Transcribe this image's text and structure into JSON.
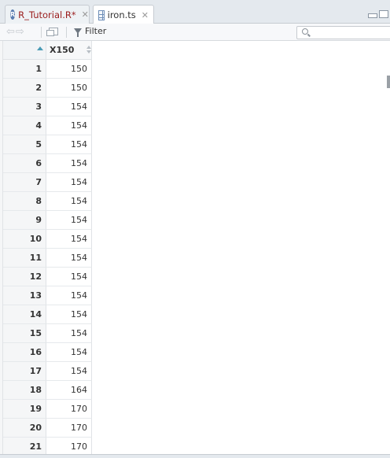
{
  "tabs": [
    {
      "label": "R_Tutorial.R*",
      "icon": "r-script-icon",
      "active": false
    },
    {
      "label": "iron.ts",
      "icon": "data-grid-icon",
      "active": true
    }
  ],
  "toolbar": {
    "filter_label": "Filter",
    "search_placeholder": ""
  },
  "table": {
    "column_header": "X150",
    "rows": [
      {
        "index": "1",
        "value": "150"
      },
      {
        "index": "2",
        "value": "150"
      },
      {
        "index": "3",
        "value": "154"
      },
      {
        "index": "4",
        "value": "154"
      },
      {
        "index": "5",
        "value": "154"
      },
      {
        "index": "6",
        "value": "154"
      },
      {
        "index": "7",
        "value": "154"
      },
      {
        "index": "8",
        "value": "154"
      },
      {
        "index": "9",
        "value": "154"
      },
      {
        "index": "10",
        "value": "154"
      },
      {
        "index": "11",
        "value": "154"
      },
      {
        "index": "12",
        "value": "154"
      },
      {
        "index": "13",
        "value": "154"
      },
      {
        "index": "14",
        "value": "154"
      },
      {
        "index": "15",
        "value": "154"
      },
      {
        "index": "16",
        "value": "154"
      },
      {
        "index": "17",
        "value": "154"
      },
      {
        "index": "18",
        "value": "164"
      },
      {
        "index": "19",
        "value": "170"
      },
      {
        "index": "20",
        "value": "170"
      },
      {
        "index": "21",
        "value": "170"
      }
    ]
  },
  "colors": {
    "modified_tab_text": "#9a1c1c",
    "sort_indicator": "#4a9bb5"
  }
}
